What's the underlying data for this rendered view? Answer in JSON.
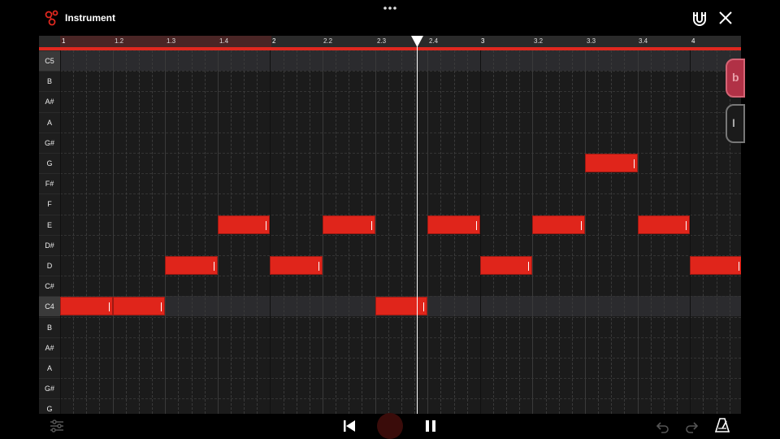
{
  "header": {
    "title": "Instrument",
    "icons": [
      "instrument-logo-icon",
      "more-options-icon",
      "snap-magnet-icon",
      "close-icon"
    ]
  },
  "ruler": {
    "ticks": [
      "1",
      "1.2",
      "1.3",
      "1.4",
      "2",
      "2.2",
      "2.3",
      "2.4",
      "3",
      "3.2",
      "3.3",
      "3.4",
      "4"
    ]
  },
  "keyboard": {
    "keys": [
      "C5",
      "B",
      "A#",
      "A",
      "G#",
      "G",
      "F#",
      "F",
      "E",
      "D#",
      "D",
      "C#",
      "C4",
      "B",
      "A#",
      "A",
      "G#",
      "G"
    ]
  },
  "notes": [
    {
      "pitch": "C4",
      "start_beat": 1.0,
      "length_beats": 1
    },
    {
      "pitch": "C4",
      "start_beat": 2.0,
      "length_beats": 1
    },
    {
      "pitch": "D",
      "start_beat": 3.0,
      "length_beats": 1
    },
    {
      "pitch": "E",
      "start_beat": 4.0,
      "length_beats": 1
    },
    {
      "pitch": "D",
      "start_beat": 5.0,
      "length_beats": 1
    },
    {
      "pitch": "E",
      "start_beat": 6.0,
      "length_beats": 1
    },
    {
      "pitch": "C4",
      "start_beat": 7.0,
      "length_beats": 1
    },
    {
      "pitch": "E",
      "start_beat": 8.0,
      "length_beats": 1
    },
    {
      "pitch": "D",
      "start_beat": 9.0,
      "length_beats": 1
    },
    {
      "pitch": "E",
      "start_beat": 10.0,
      "length_beats": 1
    },
    {
      "pitch": "G",
      "start_beat": 11.0,
      "length_beats": 1
    },
    {
      "pitch": "E",
      "start_beat": 12.0,
      "length_beats": 1
    },
    {
      "pitch": "D",
      "start_beat": 13.0,
      "length_beats": 1
    }
  ],
  "side_buttons": {
    "top_glyph": "b",
    "bottom_glyph": "I"
  },
  "transport": {
    "icons": [
      "mixer-settings-icon",
      "skip-to-start-icon",
      "record-button",
      "pause-icon",
      "undo-icon",
      "redo-icon",
      "metronome-icon"
    ]
  },
  "colors": {
    "accent": "#e0281f",
    "background": "#1b1b1b",
    "note": "#e0251b"
  }
}
